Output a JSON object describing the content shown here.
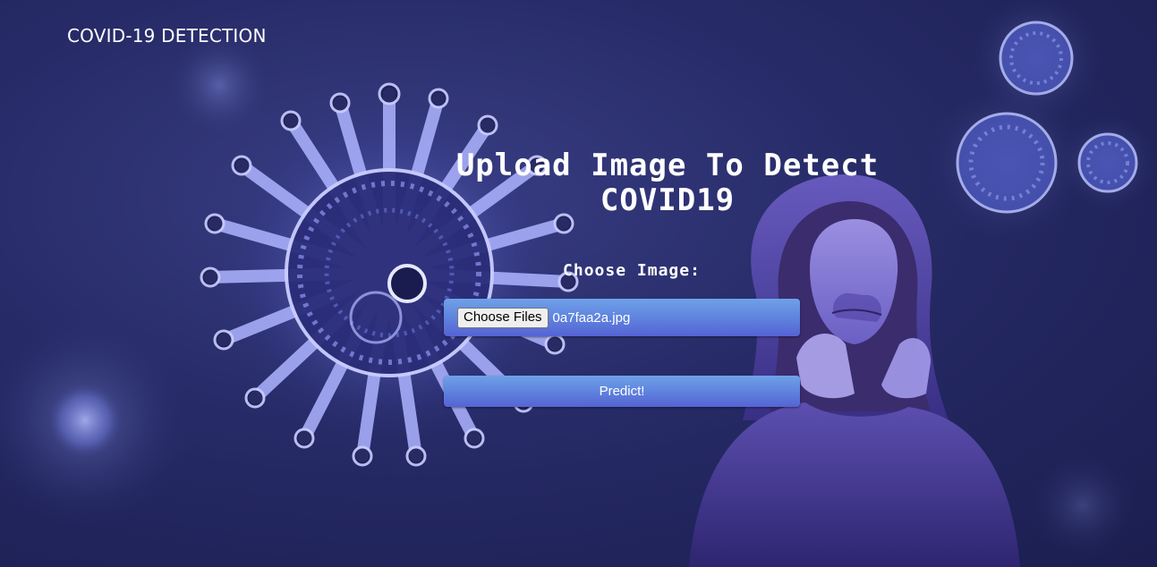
{
  "nav": {
    "brand": "COVID-19 DETECTION"
  },
  "main": {
    "heading_line1": "Upload Image To Detect",
    "heading_line2": "COVID19",
    "choose_label": "Choose Image:",
    "file_input": {
      "button_label": "Choose Files",
      "selected_file": "0a7faa2a.jpg"
    },
    "predict_label": "Predict!"
  },
  "background": {
    "icons": [
      "virus-illustration-icon",
      "person-sneezing-illustration-icon"
    ]
  },
  "colors": {
    "background_dark": "#1b1e4f",
    "background_mid": "#2c3070",
    "button_top": "#6fa1e8",
    "button_bottom": "#5563d4",
    "text": "#ffffff"
  }
}
